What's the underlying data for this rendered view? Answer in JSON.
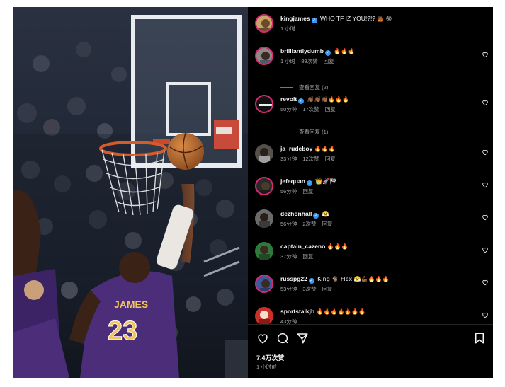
{
  "post": {
    "caption_user": "kingjames",
    "caption_text": "WHO TF IZ YOU!?!?",
    "caption_emoji": "🤷🏾 😝",
    "caption_time": "1 小时"
  },
  "comments": [
    {
      "user": "brilliantlydumb",
      "verified": true,
      "text": "🔥🔥🔥",
      "time": "1 小时",
      "likes": "89次赞",
      "reply": "回复",
      "view_replies": "查看回复 (2)"
    },
    {
      "user": "revolt",
      "verified": true,
      "text": "👏🏾👏🏾👏🏾🔥🔥🔥",
      "time": "50分钟",
      "likes": "17次赞",
      "reply": "回复",
      "view_replies": "查看回复 (1)"
    },
    {
      "user": "ja_rudeboy",
      "verified": false,
      "text": "🔥🔥🔥",
      "time": "33分钟",
      "likes": "12次赞",
      "reply": "回复"
    },
    {
      "user": "jefequan",
      "verified": true,
      "text": "👑🚀🏁",
      "time": "56分钟",
      "likes": "",
      "reply": "回复"
    },
    {
      "user": "dezhonhall",
      "verified": true,
      "text": "😤",
      "time": "56分钟",
      "likes": "2次赞",
      "reply": "回复"
    },
    {
      "user": "captain_cazeno",
      "verified": false,
      "text": "🔥🔥🔥",
      "time": "37分钟",
      "likes": "",
      "reply": "回复"
    },
    {
      "user": "russpg22",
      "verified": true,
      "text": "King 🐐 Flex 😤💪🏾🔥🔥🔥",
      "time": "53分钟",
      "likes": "3次赞",
      "reply": "回复"
    },
    {
      "user": "sportstalkjb",
      "verified": false,
      "text": "🔥🔥🔥🔥🔥🔥🔥",
      "time": "43分钟",
      "likes": "",
      "reply": ""
    }
  ],
  "footer": {
    "likes": "7.4万次赞",
    "time": "1 小时前"
  },
  "jersey": {
    "name": "JAMES",
    "number": "23"
  },
  "colors": {
    "verified": "#3897f0",
    "background": "#000000",
    "meta": "#a8a8a8",
    "fire": "#ff7a1a",
    "lakers_purple": "#4b2d7a"
  }
}
